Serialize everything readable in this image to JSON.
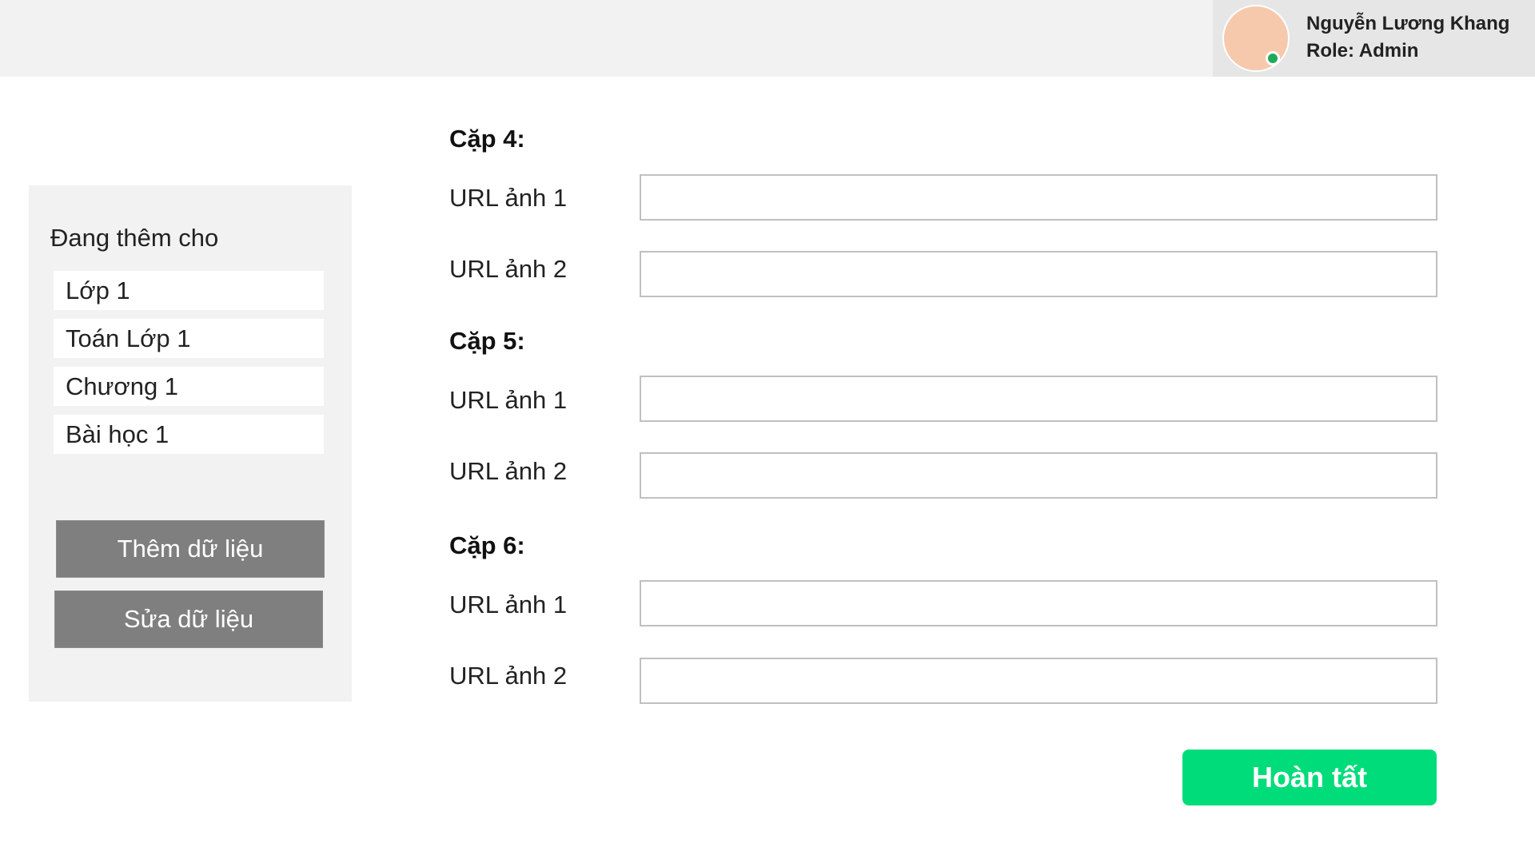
{
  "user": {
    "name": "Nguyễn Lương Khang",
    "role": "Role: Admin",
    "status_color": "#1faa59",
    "avatar_color": "#f6c9ad"
  },
  "sidebar": {
    "heading": "Đang thêm cho",
    "context": {
      "grade": "Lớp 1",
      "subject": "Toán Lớp 1",
      "chapter": "Chương 1",
      "lesson": "Bài học 1"
    },
    "add_label": "Thêm dữ liệu",
    "edit_label": "Sửa dữ liệu"
  },
  "form": {
    "pairs": [
      {
        "title": "Cặp 4:",
        "url1_label": "URL ảnh 1",
        "url1_value": "",
        "url2_label": "URL ảnh 2",
        "url2_value": ""
      },
      {
        "title": "Cặp 5:",
        "url1_label": "URL ảnh 1",
        "url1_value": "",
        "url2_label": "URL ảnh 2",
        "url2_value": ""
      },
      {
        "title": "Cặp 6:",
        "url1_label": "URL ảnh 1",
        "url1_value": "",
        "url2_label": "URL ảnh 2",
        "url2_value": ""
      }
    ],
    "submit_label": "Hoàn tất",
    "submit_color": "#00dc7a"
  }
}
